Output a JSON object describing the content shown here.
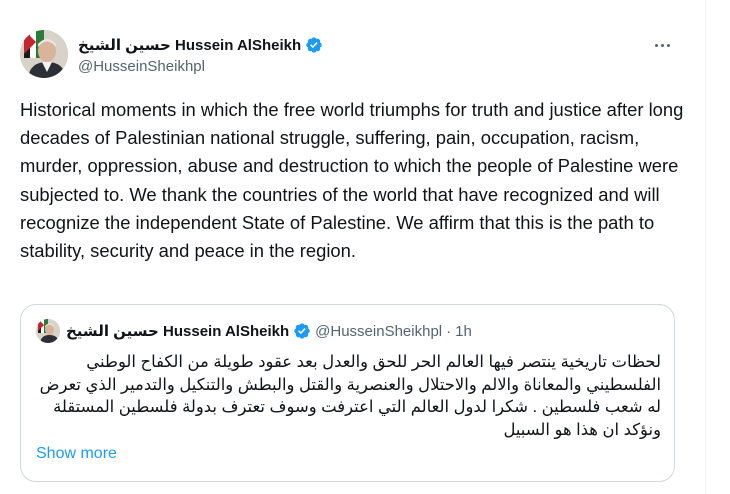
{
  "author": {
    "display_name": "حسين الشيخ Hussein AlSheikh",
    "handle": "@HusseinSheikhpl",
    "verified_icon": "verified-badge-icon",
    "accent_color": "#1d9bf0"
  },
  "more_icon": "more-horizontal-icon",
  "tweet_text": "Historical moments in which the free world triumphs for truth and justice after long decades of Palestinian national struggle, suffering, pain, occupation, racism, murder, oppression, abuse and destruction to which the people of Palestine were subjected to. We thank the countries of the world that have recognized and will recognize the independent State of Palestine. We affirm that this is the path to stability, security and peace in the region.",
  "quoted": {
    "display_name": "حسين الشيخ Hussein AlSheikh",
    "handle": "@HusseinSheikhpl",
    "separator": "·",
    "time": "1h",
    "text": "لحظات تاريخية ينتصر فيها العالم الحر للحق والعدل بعد عقود طويلة من الكفاح الوطني الفلسطيني والمعاناة والالم والاحتلال والعنصرية والقتل والبطش والتنكيل والتدمير الذي تعرض له شعب فلسطين . شكرا لدول العالم التي اعترفت وسوف تعترف بدولة فلسطين المستقلة ونؤكد ان هذا هو السبيل",
    "show_more": "Show more"
  }
}
